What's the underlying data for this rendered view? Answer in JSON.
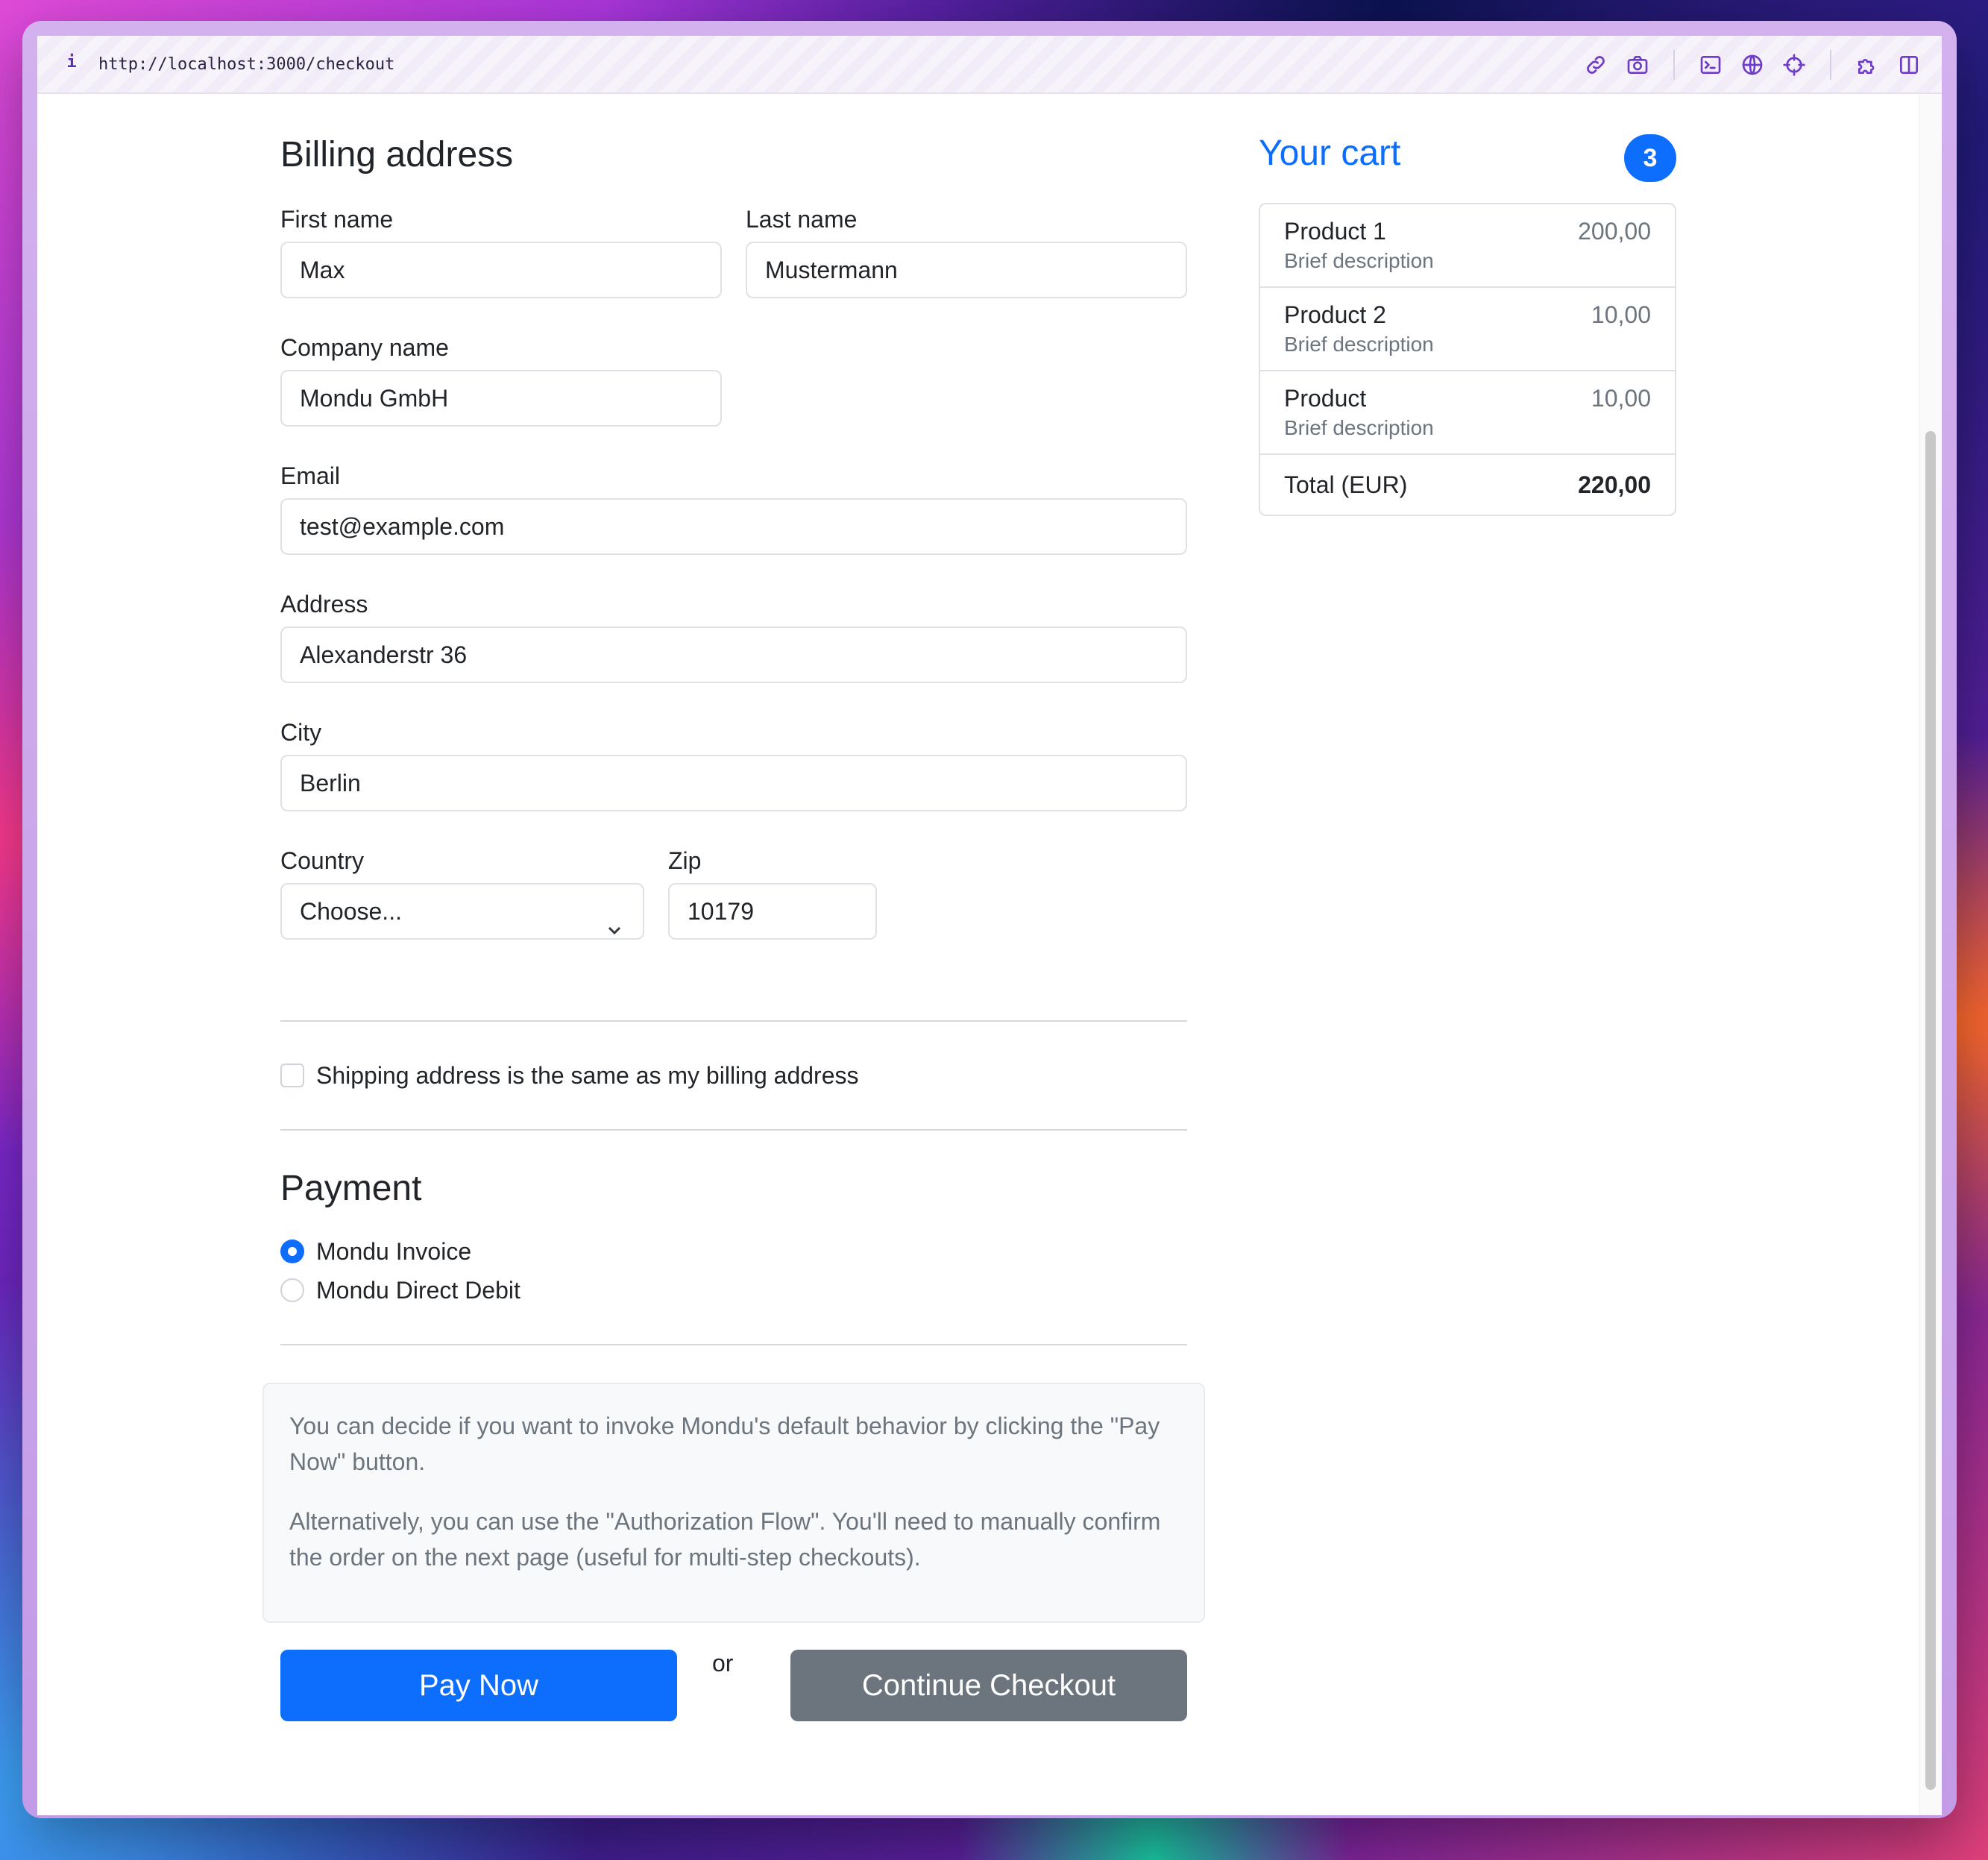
{
  "browser": {
    "url": "http://localhost:3000/checkout",
    "info_icon": "i",
    "toolbar_icons": [
      "link-icon",
      "camera-icon",
      "terminal-icon",
      "globe-icon",
      "crosshair-icon",
      "puzzle-icon",
      "sidebar-icon"
    ]
  },
  "billing": {
    "title": "Billing address",
    "first_name_label": "First name",
    "first_name_value": "Max",
    "last_name_label": "Last name",
    "last_name_value": "Mustermann",
    "company_label": "Company name",
    "company_value": "Mondu GmbH",
    "email_label": "Email",
    "email_value": "test@example.com",
    "address_label": "Address",
    "address_value": "Alexanderstr 36",
    "city_label": "City",
    "city_value": "Berlin",
    "country_label": "Country",
    "country_value": "Choose...",
    "zip_label": "Zip",
    "zip_value": "10179",
    "same_address_label": "Shipping address is the same as my billing address",
    "same_address_checked": false
  },
  "payment": {
    "title": "Payment",
    "options": [
      {
        "label": "Mondu Invoice",
        "checked": true
      },
      {
        "label": "Mondu Direct Debit",
        "checked": false
      }
    ]
  },
  "info": {
    "paragraph1": "You can decide if you want to invoke Mondu's default behavior by clicking the \"Pay Now\" button.",
    "paragraph2": "Alternatively, you can use the \"Authorization Flow\". You'll need to manually confirm the order on the next page (useful for multi-step checkouts)."
  },
  "actions": {
    "pay_now": "Pay Now",
    "or": "or",
    "continue_checkout": "Continue Checkout"
  },
  "cart": {
    "title": "Your cart",
    "count": "3",
    "items": [
      {
        "name": "Product 1",
        "description": "Brief description",
        "price": "200,00"
      },
      {
        "name": "Product 2",
        "description": "Brief description",
        "price": "10,00"
      },
      {
        "name": "Product",
        "description": "Brief description",
        "price": "10,00"
      }
    ],
    "total_label": "Total (EUR)",
    "total_value": "220,00"
  },
  "colors": {
    "primary": "#0d6efd",
    "secondary": "#6c757d",
    "toolbar_icon": "#6d3cc8"
  }
}
